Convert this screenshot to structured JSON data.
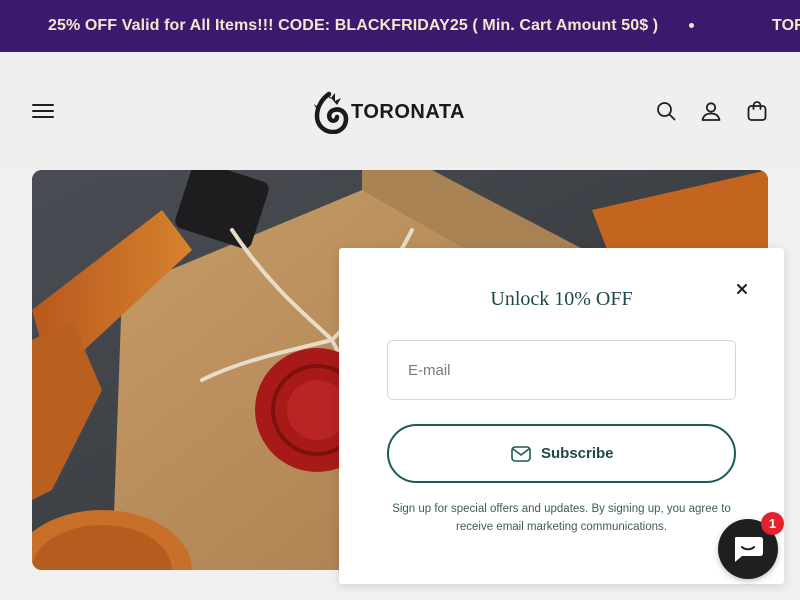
{
  "announcement": {
    "message": "25% OFF Valid for All Items!!! CODE: BLACKFRIDAY25 ( Min. Cart Amount 50$ )",
    "next_message_partial": "TOR"
  },
  "header": {
    "logo_text": "TORONATA",
    "icons": [
      "menu-icon",
      "search-icon",
      "account-icon",
      "cart-icon"
    ]
  },
  "hero": {
    "icons": [
      "leather-watch-strap",
      "kraft-gift-box",
      "red-wax-seal",
      "twine-bow"
    ]
  },
  "popup": {
    "title": "Unlock 10% OFF",
    "email_placeholder": "E-mail",
    "subscribe_label": "Subscribe",
    "disclaimer": "Sign up for special offers and updates. By signing up, you agree to receive email marketing communications."
  },
  "chat": {
    "unread_count": "1"
  },
  "colors": {
    "announcement_bg": "#3b1a6e",
    "announcement_text": "#f3e7cf",
    "accent_teal": "#1c5a57",
    "badge_red": "#e5202f"
  }
}
